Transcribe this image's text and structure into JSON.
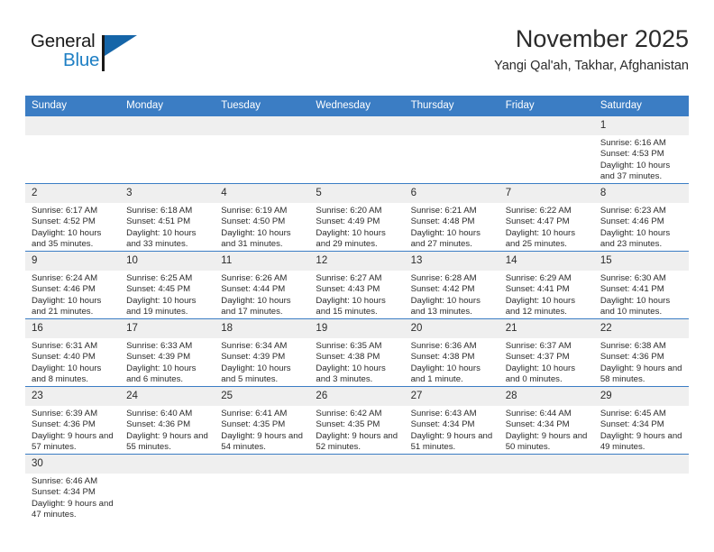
{
  "brand": {
    "name_top": "General",
    "name_bottom": "Blue",
    "accent_color": "#1e7fc4",
    "triangle_color": "#1565a8"
  },
  "header": {
    "title": "November 2025",
    "subtitle": "Yangi Qal'ah, Takhar, Afghanistan"
  },
  "theme": {
    "header_row_bg": "#3b7dc4",
    "header_row_text": "#ffffff",
    "daynum_bg": "#efefef",
    "cell_border": "#3b7dc4",
    "text": "#2b2b2b"
  },
  "weekdays": [
    "Sunday",
    "Monday",
    "Tuesday",
    "Wednesday",
    "Thursday",
    "Friday",
    "Saturday"
  ],
  "labels": {
    "sunrise_prefix": "Sunrise: ",
    "sunset_prefix": "Sunset: ",
    "daylight_prefix": "Daylight: "
  },
  "weeks": [
    [
      {
        "empty": true
      },
      {
        "empty": true
      },
      {
        "empty": true
      },
      {
        "empty": true
      },
      {
        "empty": true
      },
      {
        "empty": true
      },
      {
        "day": "1",
        "sunrise": "Sunrise: 6:16 AM",
        "sunset": "Sunset: 4:53 PM",
        "daylight": "Daylight: 10 hours and 37 minutes."
      }
    ],
    [
      {
        "day": "2",
        "sunrise": "Sunrise: 6:17 AM",
        "sunset": "Sunset: 4:52 PM",
        "daylight": "Daylight: 10 hours and 35 minutes."
      },
      {
        "day": "3",
        "sunrise": "Sunrise: 6:18 AM",
        "sunset": "Sunset: 4:51 PM",
        "daylight": "Daylight: 10 hours and 33 minutes."
      },
      {
        "day": "4",
        "sunrise": "Sunrise: 6:19 AM",
        "sunset": "Sunset: 4:50 PM",
        "daylight": "Daylight: 10 hours and 31 minutes."
      },
      {
        "day": "5",
        "sunrise": "Sunrise: 6:20 AM",
        "sunset": "Sunset: 4:49 PM",
        "daylight": "Daylight: 10 hours and 29 minutes."
      },
      {
        "day": "6",
        "sunrise": "Sunrise: 6:21 AM",
        "sunset": "Sunset: 4:48 PM",
        "daylight": "Daylight: 10 hours and 27 minutes."
      },
      {
        "day": "7",
        "sunrise": "Sunrise: 6:22 AM",
        "sunset": "Sunset: 4:47 PM",
        "daylight": "Daylight: 10 hours and 25 minutes."
      },
      {
        "day": "8",
        "sunrise": "Sunrise: 6:23 AM",
        "sunset": "Sunset: 4:46 PM",
        "daylight": "Daylight: 10 hours and 23 minutes."
      }
    ],
    [
      {
        "day": "9",
        "sunrise": "Sunrise: 6:24 AM",
        "sunset": "Sunset: 4:46 PM",
        "daylight": "Daylight: 10 hours and 21 minutes."
      },
      {
        "day": "10",
        "sunrise": "Sunrise: 6:25 AM",
        "sunset": "Sunset: 4:45 PM",
        "daylight": "Daylight: 10 hours and 19 minutes."
      },
      {
        "day": "11",
        "sunrise": "Sunrise: 6:26 AM",
        "sunset": "Sunset: 4:44 PM",
        "daylight": "Daylight: 10 hours and 17 minutes."
      },
      {
        "day": "12",
        "sunrise": "Sunrise: 6:27 AM",
        "sunset": "Sunset: 4:43 PM",
        "daylight": "Daylight: 10 hours and 15 minutes."
      },
      {
        "day": "13",
        "sunrise": "Sunrise: 6:28 AM",
        "sunset": "Sunset: 4:42 PM",
        "daylight": "Daylight: 10 hours and 13 minutes."
      },
      {
        "day": "14",
        "sunrise": "Sunrise: 6:29 AM",
        "sunset": "Sunset: 4:41 PM",
        "daylight": "Daylight: 10 hours and 12 minutes."
      },
      {
        "day": "15",
        "sunrise": "Sunrise: 6:30 AM",
        "sunset": "Sunset: 4:41 PM",
        "daylight": "Daylight: 10 hours and 10 minutes."
      }
    ],
    [
      {
        "day": "16",
        "sunrise": "Sunrise: 6:31 AM",
        "sunset": "Sunset: 4:40 PM",
        "daylight": "Daylight: 10 hours and 8 minutes."
      },
      {
        "day": "17",
        "sunrise": "Sunrise: 6:33 AM",
        "sunset": "Sunset: 4:39 PM",
        "daylight": "Daylight: 10 hours and 6 minutes."
      },
      {
        "day": "18",
        "sunrise": "Sunrise: 6:34 AM",
        "sunset": "Sunset: 4:39 PM",
        "daylight": "Daylight: 10 hours and 5 minutes."
      },
      {
        "day": "19",
        "sunrise": "Sunrise: 6:35 AM",
        "sunset": "Sunset: 4:38 PM",
        "daylight": "Daylight: 10 hours and 3 minutes."
      },
      {
        "day": "20",
        "sunrise": "Sunrise: 6:36 AM",
        "sunset": "Sunset: 4:38 PM",
        "daylight": "Daylight: 10 hours and 1 minute."
      },
      {
        "day": "21",
        "sunrise": "Sunrise: 6:37 AM",
        "sunset": "Sunset: 4:37 PM",
        "daylight": "Daylight: 10 hours and 0 minutes."
      },
      {
        "day": "22",
        "sunrise": "Sunrise: 6:38 AM",
        "sunset": "Sunset: 4:36 PM",
        "daylight": "Daylight: 9 hours and 58 minutes."
      }
    ],
    [
      {
        "day": "23",
        "sunrise": "Sunrise: 6:39 AM",
        "sunset": "Sunset: 4:36 PM",
        "daylight": "Daylight: 9 hours and 57 minutes."
      },
      {
        "day": "24",
        "sunrise": "Sunrise: 6:40 AM",
        "sunset": "Sunset: 4:36 PM",
        "daylight": "Daylight: 9 hours and 55 minutes."
      },
      {
        "day": "25",
        "sunrise": "Sunrise: 6:41 AM",
        "sunset": "Sunset: 4:35 PM",
        "daylight": "Daylight: 9 hours and 54 minutes."
      },
      {
        "day": "26",
        "sunrise": "Sunrise: 6:42 AM",
        "sunset": "Sunset: 4:35 PM",
        "daylight": "Daylight: 9 hours and 52 minutes."
      },
      {
        "day": "27",
        "sunrise": "Sunrise: 6:43 AM",
        "sunset": "Sunset: 4:34 PM",
        "daylight": "Daylight: 9 hours and 51 minutes."
      },
      {
        "day": "28",
        "sunrise": "Sunrise: 6:44 AM",
        "sunset": "Sunset: 4:34 PM",
        "daylight": "Daylight: 9 hours and 50 minutes."
      },
      {
        "day": "29",
        "sunrise": "Sunrise: 6:45 AM",
        "sunset": "Sunset: 4:34 PM",
        "daylight": "Daylight: 9 hours and 49 minutes."
      }
    ],
    [
      {
        "day": "30",
        "sunrise": "Sunrise: 6:46 AM",
        "sunset": "Sunset: 4:34 PM",
        "daylight": "Daylight: 9 hours and 47 minutes."
      },
      {
        "empty": true
      },
      {
        "empty": true
      },
      {
        "empty": true
      },
      {
        "empty": true
      },
      {
        "empty": true
      },
      {
        "empty": true
      }
    ]
  ]
}
